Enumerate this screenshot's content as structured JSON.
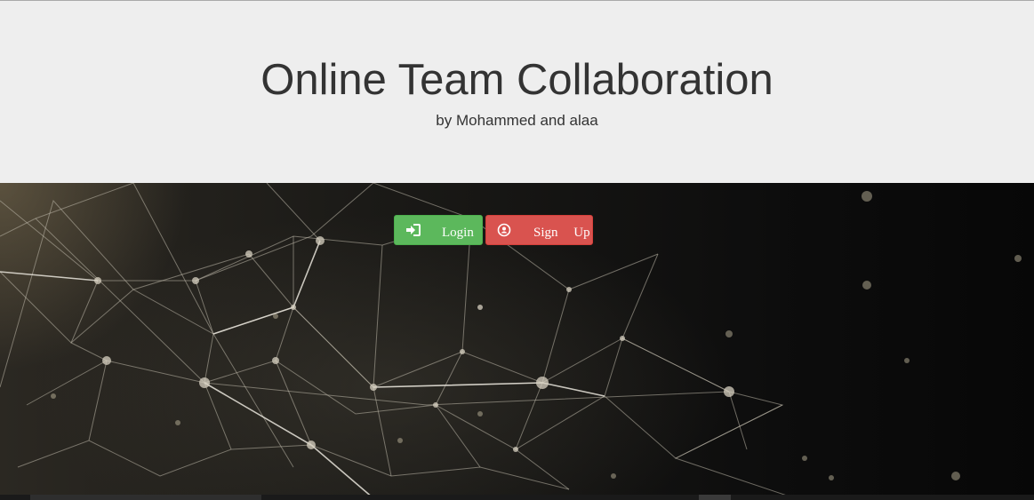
{
  "header": {
    "title": "Online Team Collaboration",
    "subtitle": "by Mohammed and alaa"
  },
  "actions": {
    "login": {
      "label": "Login",
      "icon": "sign-in-icon",
      "color": "#5cb85c"
    },
    "signup": {
      "label": "Sign Up",
      "icon": "user-circle-icon",
      "color": "#d9534f"
    }
  },
  "hero": {
    "background": "network-plexus-image"
  }
}
